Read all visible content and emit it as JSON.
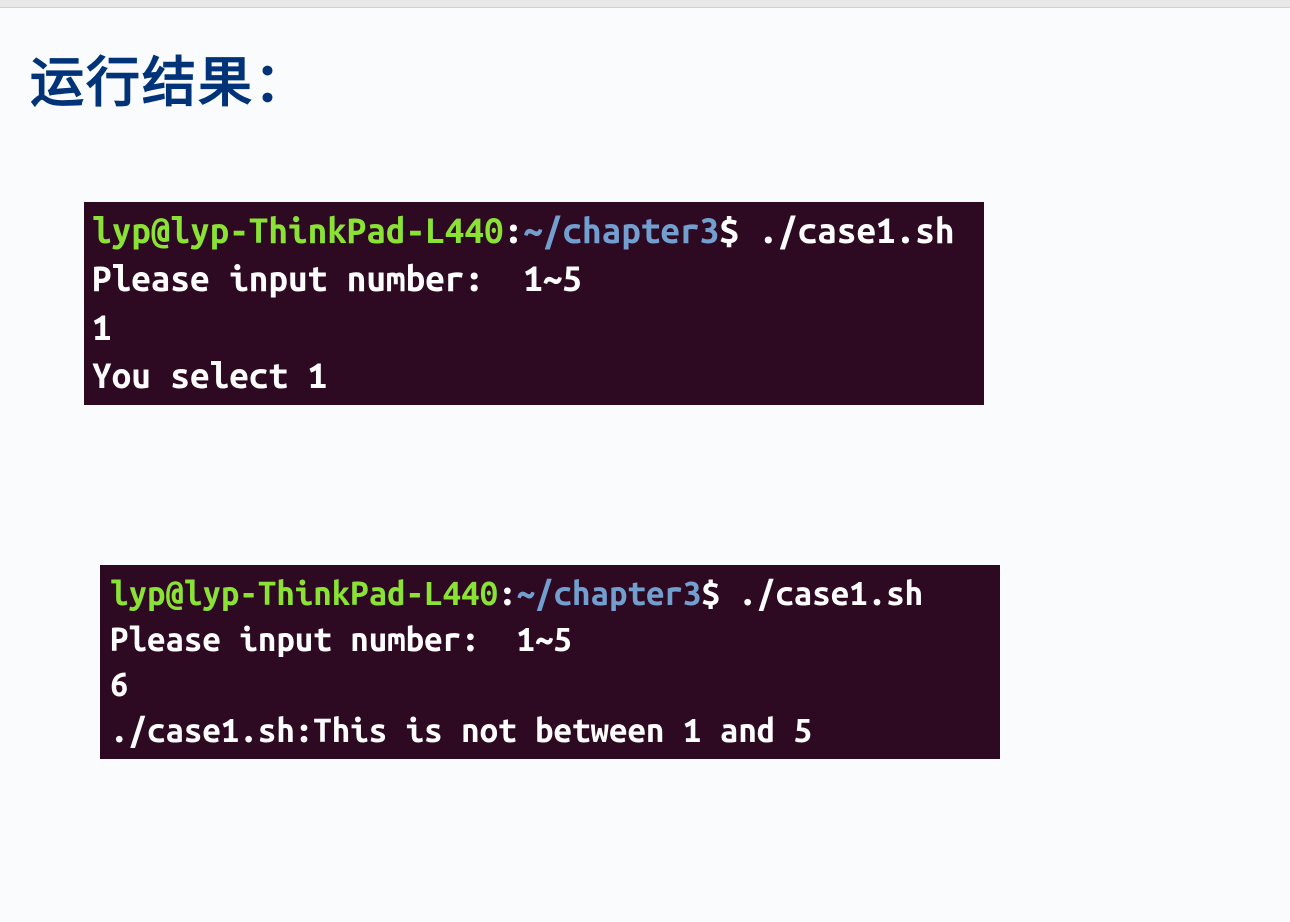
{
  "heading": "运行结果：",
  "terminal1": {
    "user": "lyp@lyp-ThinkPad-L440",
    "colon": ":",
    "path": "~/chapter3",
    "dollar": "$",
    "cmd": " ./case1.sh",
    "line2": "Please input number:  1~5",
    "line3": "1",
    "line4": "You select 1"
  },
  "terminal2": {
    "user": "lyp@lyp-ThinkPad-L440",
    "colon": ":",
    "path": "~/chapter3",
    "dollar": "$",
    "cmd": " ./case1.sh",
    "line2": "Please input number:  1~5",
    "line3": "6",
    "line4": "./case1.sh:This is not between 1 and 5"
  }
}
